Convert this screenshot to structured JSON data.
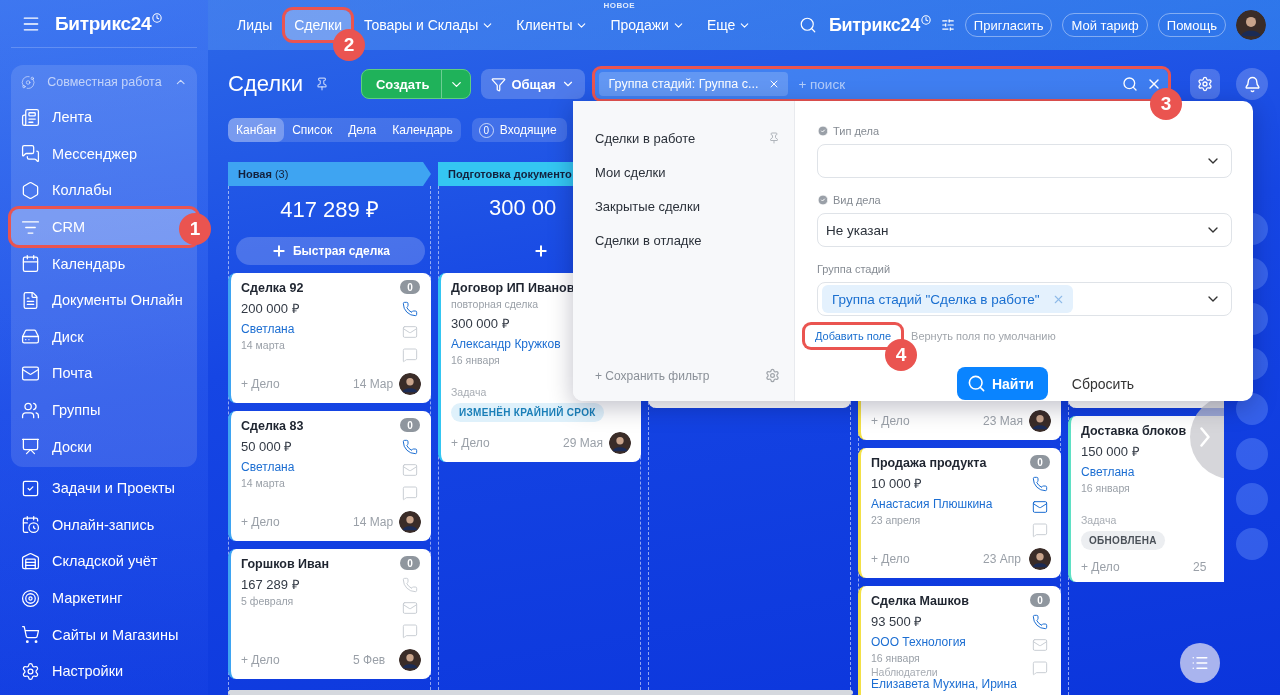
{
  "sidebar": {
    "logo": "Битрикс24",
    "group": {
      "title": "Совместная работа",
      "expanded": true,
      "items": [
        {
          "label": "Лента",
          "selected": false
        },
        {
          "label": "Мессенджер",
          "selected": false
        },
        {
          "label": "Коллабы",
          "selected": false
        },
        {
          "label": "CRM",
          "selected": true,
          "callout": "1"
        },
        {
          "label": "Календарь",
          "selected": false
        },
        {
          "label": "Документы Онлайн",
          "selected": false
        },
        {
          "label": "Диск",
          "selected": false
        },
        {
          "label": "Почта",
          "selected": false
        },
        {
          "label": "Группы",
          "selected": false
        },
        {
          "label": "Доски",
          "selected": false
        }
      ]
    },
    "items": [
      {
        "label": "Задачи и Проекты",
        "selected": false
      },
      {
        "label": "Онлайн-запись",
        "selected": false
      },
      {
        "label": "Складской учёт",
        "selected": false
      },
      {
        "label": "Маркетинг",
        "selected": false
      },
      {
        "label": "Сайты и Магазины",
        "selected": false
      },
      {
        "label": "Настройки",
        "selected": false
      }
    ]
  },
  "topbar": {
    "nav": [
      {
        "label": "Лиды",
        "selected": false,
        "dropdown": false
      },
      {
        "label": "Сделки",
        "selected": true,
        "dropdown": false,
        "callout": "2"
      },
      {
        "label": "Товары и Склады",
        "selected": false,
        "dropdown": true
      },
      {
        "label": "Клиенты",
        "selected": false,
        "dropdown": true
      },
      {
        "label": "Продажи",
        "selected": false,
        "dropdown": true,
        "badge": "НОВОЕ"
      },
      {
        "label": "Еще",
        "selected": false,
        "dropdown": true
      }
    ],
    "logo": "Битрикс24",
    "buttons": [
      "Пригласить",
      "Мой тариф",
      "Помощь"
    ]
  },
  "header": {
    "title": "Сделки",
    "create": "Создать",
    "category": "Общая",
    "filter": {
      "chip": "Группа стадий: Группа с...",
      "placeholder": "+ поиск",
      "callout": "3"
    }
  },
  "views": [
    {
      "label": "Канбан",
      "selected": true
    },
    {
      "label": "Список",
      "selected": false
    },
    {
      "label": "Дела",
      "selected": false
    },
    {
      "label": "Календарь",
      "selected": false
    }
  ],
  "inbox": {
    "count": "0",
    "label": "Входящие"
  },
  "columns": [
    {
      "kind": "full",
      "title": "**Новая** (3)",
      "color": "#3ea4f2",
      "total": "417 289 ₽",
      "quick_add": "Быстрая сделка",
      "cards": [
        {
          "kind": "deal",
          "title": "Сделка 92",
          "amount": "200 000 ₽",
          "contact": "Светлана",
          "date": "14 марта",
          "add": "+ Дело",
          "footer_date": "14 Мар",
          "avatar": true,
          "counter": "0",
          "comms": {
            "phone": true,
            "mail": false,
            "chat": false
          }
        },
        {
          "kind": "deal",
          "title": "Сделка 83",
          "amount": "50 000 ₽",
          "contact": "Светлана",
          "date": "14 марта",
          "add": "+ Дело",
          "footer_date": "14 Мар",
          "avatar": true,
          "counter": "0",
          "comms": {
            "phone": true,
            "mail": false,
            "chat": false
          }
        },
        {
          "kind": "deal",
          "title": "Горшков Иван",
          "amount": "167 289 ₽",
          "date": "5 февраля",
          "add": "+ Дело",
          "footer_date": "5 Фев",
          "avatar": true,
          "counter": "0",
          "comms": {
            "phone": false,
            "mail": false,
            "chat": false
          }
        }
      ]
    },
    {
      "kind": "full",
      "title": "**Подготовка документо**",
      "color": "#34c6f2",
      "total": "300 00",
      "cards": [
        {
          "kind": "deal",
          "title": "Договор ИП Иванов",
          "subtitle": "повторная сделка",
          "amount": "300 000 ₽",
          "contact": "Александр Кружков",
          "date": "16 января",
          "task_label": "Задача",
          "status": {
            "label": "ИЗМЕНЁН КРАЙНИЙ СРОК",
            "color": "#dff1fb"
          },
          "add": "+ Дело",
          "footer_date": "29 Мая",
          "avatar": true
        }
      ]
    },
    {
      "kind": "covered",
      "cards": [
        {
          "kind": "covered"
        }
      ]
    },
    {
      "kind": "covered",
      "color": "#f3e046",
      "cards": [
        {
          "kind": "partial",
          "add": "+ Дело",
          "footer_date": "23 Мая",
          "avatar": true
        },
        {
          "kind": "deal",
          "title": "Продажа продукта",
          "amount": "10 000 ₽",
          "contact": "Анастасия Плюшкина",
          "date": "23 апреля",
          "add": "+ Дело",
          "footer_date": "23 Апр",
          "avatar": true,
          "counter": "0",
          "comms": {
            "phone": true,
            "mail": true,
            "chat": false
          }
        },
        {
          "kind": "deal",
          "title": "Сделка Машков",
          "amount": "93 500 ₽",
          "contact": "ООО Технология",
          "date": "16 января",
          "observers_label": "Наблюдатели",
          "observers": "Елизавета Мухина, Ирина",
          "counter": "0",
          "comms": {
            "phone": true,
            "mail": false,
            "chat": false
          }
        }
      ]
    },
    {
      "kind": "covered",
      "color": "#5fe0c4",
      "cards": [
        {
          "kind": "covered"
        },
        {
          "kind": "deal",
          "title": "Доставка блоков",
          "amount": "150 000 ₽",
          "contact": "Светлана",
          "date": "16 января",
          "task_label": "Задача",
          "status": {
            "label": "ОБНОВЛЕНА",
            "color": "#eceef1"
          },
          "add": "+ Дело",
          "footer_date": "25",
          "avatar": false
        }
      ]
    }
  ],
  "popup": {
    "presets": [
      {
        "label": "Сделки в работе",
        "pinned": true
      },
      {
        "label": "Мои сделки",
        "pinned": false
      },
      {
        "label": "Закрытые сделки",
        "pinned": false
      },
      {
        "label": "Сделки в отладке",
        "pinned": false
      }
    ],
    "save": "+ Сохранить фильтр",
    "fields": [
      {
        "label": "Тип дела",
        "marked": true
      },
      {
        "label": "Вид дела",
        "marked": true,
        "value": "Не указан"
      },
      {
        "label": "Группа стадий",
        "marked": false,
        "chip": "Группа стадий \"Сделка в работе\""
      }
    ],
    "add_field": {
      "label": "Добавить поле",
      "callout": "4"
    },
    "restore": "Вернуть поля по умолчанию",
    "find": "Найти",
    "reset": "Сбросить"
  }
}
